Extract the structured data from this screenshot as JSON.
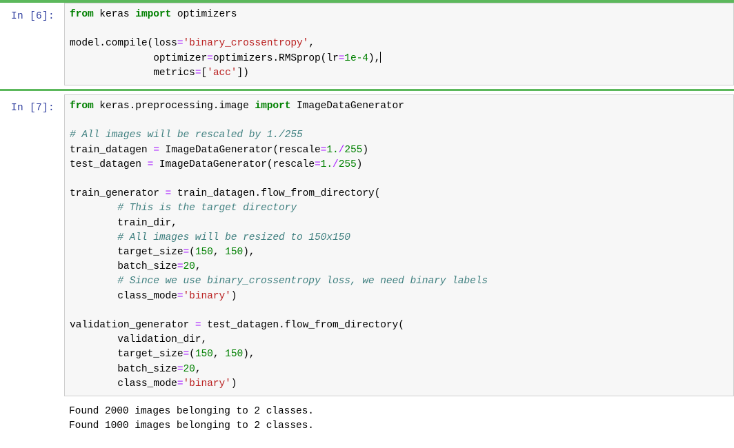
{
  "notebook": {
    "accent_color": "#5cb85c",
    "prompt_color": "#303f9f",
    "cell_bg": "#f7f7f7",
    "cell_border": "#cfcfcf",
    "syntax_colors": {
      "keyword": "#008000",
      "string": "#ba2121",
      "comment": "#408080",
      "number": "#008000",
      "operator": "#aa22ff",
      "text": "#000000"
    },
    "cells": [
      {
        "prompt": "In [6]:",
        "execution_count": 6,
        "type": "code",
        "source": "from keras import optimizers\n\nmodel.compile(loss='binary_crossentropy',\n              optimizer=optimizers.RMSprop(lr=1e-4),\n              metrics=['acc'])",
        "has_cursor": true
      },
      {
        "prompt": "In [7]:",
        "execution_count": 7,
        "type": "code",
        "source": "from keras.preprocessing.image import ImageDataGenerator\n\n# All images will be rescaled by 1./255\ntrain_datagen = ImageDataGenerator(rescale=1./255)\ntest_datagen = ImageDataGenerator(rescale=1./255)\n\ntrain_generator = train_datagen.flow_from_directory(\n        # This is the target directory\n        train_dir,\n        # All images will be resized to 150x150\n        target_size=(150, 150),\n        batch_size=20,\n        # Since we use binary_crossentropy loss, we need binary labels\n        class_mode='binary')\n\nvalidation_generator = test_datagen.flow_from_directory(\n        validation_dir,\n        target_size=(150, 150),\n        batch_size=20,\n        class_mode='binary')",
        "output": {
          "type": "stream",
          "text": "Found 2000 images belonging to 2 classes.\nFound 1000 images belonging to 2 classes."
        }
      }
    ]
  },
  "tokens": {
    "cell6": {
      "l1_kw_from": "from",
      "l1_mod": " keras ",
      "l1_kw_import": "import",
      "l1_name": " optimizers",
      "l3_a": "model.compile(loss",
      "l3_eq": "=",
      "l3_str": "'binary_crossentropy'",
      "l3_comma": ",",
      "l4_a": "              optimizer",
      "l4_eq": "=",
      "l4_b": "optimizers.RMSprop(lr",
      "l4_eq2": "=",
      "l4_num": "1e-4",
      "l4_c": "),",
      "l5_a": "              metrics",
      "l5_eq": "=",
      "l5_b": "[",
      "l5_str": "'acc'",
      "l5_c": "])"
    },
    "cell7": {
      "l1_kw_from": "from",
      "l1_mod": " keras.preprocessing.image ",
      "l1_kw_import": "import",
      "l1_name": " ImageDataGenerator",
      "c1": "# All images will be rescaled by 1./255",
      "l4_a": "train_datagen ",
      "l4_eq": "=",
      "l4_b": " ImageDataGenerator(rescale",
      "l4_eq2": "=",
      "l4_n1": "1",
      "l4_dot": ".",
      "l4_div": "/",
      "l4_n2": "255",
      "l4_c": ")",
      "l5_a": "test_datagen ",
      "l5_eq": "=",
      "l5_b": " ImageDataGenerator(rescale",
      "l5_eq2": "=",
      "l5_n1": "1",
      "l5_dot": ".",
      "l5_div": "/",
      "l5_n2": "255",
      "l5_c": ")",
      "l7_a": "train_generator ",
      "l7_eq": "=",
      "l7_b": " train_datagen.flow_from_directory(",
      "c2": "        # This is the target directory",
      "l9": "        train_dir,",
      "c3": "        # All images will be resized to 150x150",
      "l11_a": "        target_size",
      "l11_eq": "=",
      "l11_b": "(",
      "l11_n1": "150",
      "l11_c": ", ",
      "l11_n2": "150",
      "l11_d": "),",
      "l12_a": "        batch_size",
      "l12_eq": "=",
      "l12_n": "20",
      "l12_b": ",",
      "c4": "        # Since we use binary_crossentropy loss, we need binary labels",
      "l14_a": "        class_mode",
      "l14_eq": "=",
      "l14_str": "'binary'",
      "l14_b": ")",
      "l16_a": "validation_generator ",
      "l16_eq": "=",
      "l16_b": " test_datagen.flow_from_directory(",
      "l17": "        validation_dir,",
      "l18_a": "        target_size",
      "l18_eq": "=",
      "l18_b": "(",
      "l18_n1": "150",
      "l18_c": ", ",
      "l18_n2": "150",
      "l18_d": "),",
      "l19_a": "        batch_size",
      "l19_eq": "=",
      "l19_n": "20",
      "l19_b": ",",
      "l20_a": "        class_mode",
      "l20_eq": "=",
      "l20_str": "'binary'",
      "l20_b": ")"
    },
    "output7": {
      "line1": "Found 2000 images belonging to 2 classes.",
      "line2": "Found 1000 images belonging to 2 classes."
    }
  }
}
